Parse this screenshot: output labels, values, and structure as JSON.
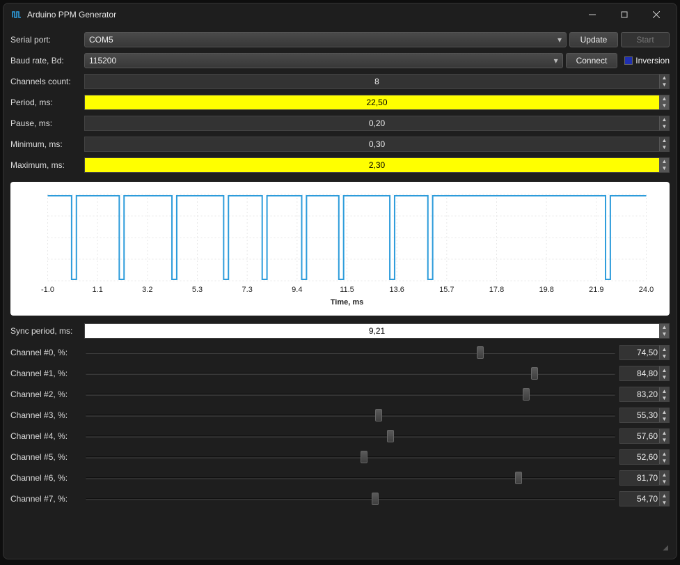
{
  "window": {
    "title": "Arduino PPM Generator"
  },
  "toolbar": {
    "serial_port_label": "Serial port:",
    "baud_rate_label": "Baud rate, Bd:",
    "serial_port_value": "COM5",
    "baud_rate_value": "115200",
    "update_label": "Update",
    "connect_label": "Connect",
    "start_label": "Start",
    "inversion_label": "Inversion",
    "inversion_checked": false
  },
  "params": {
    "channels_label": "Channels count:",
    "channels_value": "8",
    "period_label": "Period, ms:",
    "period_value": "22,50",
    "period_highlight": true,
    "pause_label": "Pause, ms:",
    "pause_value": "0,20",
    "minimum_label": "Minimum, ms:",
    "minimum_value": "0,30",
    "maximum_label": "Maximum, ms:",
    "maximum_value": "2,30",
    "maximum_highlight": true
  },
  "chart_data": {
    "type": "line",
    "xlabel": "Time, ms",
    "xlim": [
      -1.0,
      24.0
    ],
    "ylim": [
      0,
      1
    ],
    "x_ticks": [
      "-1.0",
      "1.1",
      "3.2",
      "5.3",
      "7.3",
      "9.4",
      "11.5",
      "13.6",
      "15.7",
      "17.8",
      "19.8",
      "21.9",
      "24.0"
    ],
    "pulses": [
      {
        "start": 0.0,
        "width": 0.2,
        "level_after": 1.79
      },
      {
        "start": 1.99,
        "width": 0.2,
        "level_after": 2.0
      },
      {
        "start": 4.19,
        "width": 0.2,
        "level_after": 1.96
      },
      {
        "start": 6.35,
        "width": 0.2,
        "level_after": 1.41
      },
      {
        "start": 7.96,
        "width": 0.2,
        "level_after": 1.45
      },
      {
        "start": 9.61,
        "width": 0.2,
        "level_after": 1.35
      },
      {
        "start": 11.16,
        "width": 0.2,
        "level_after": 1.93
      },
      {
        "start": 13.29,
        "width": 0.2,
        "level_after": 1.39
      },
      {
        "start": 14.88,
        "width": 0.2,
        "level_after": 7.42
      },
      {
        "start": 22.3,
        "width": 0.2,
        "level_after": 1.7
      }
    ]
  },
  "sync": {
    "label": "Sync period, ms:",
    "value": "9,21"
  },
  "channels": [
    {
      "label": "Channel #0, %:",
      "value": "74,50",
      "pct": 74.5
    },
    {
      "label": "Channel #1, %:",
      "value": "84,80",
      "pct": 84.8
    },
    {
      "label": "Channel #2, %:",
      "value": "83,20",
      "pct": 83.2
    },
    {
      "label": "Channel #3, %:",
      "value": "55,30",
      "pct": 55.3
    },
    {
      "label": "Channel #4, %:",
      "value": "57,60",
      "pct": 57.6
    },
    {
      "label": "Channel #5, %:",
      "value": "52,60",
      "pct": 52.6
    },
    {
      "label": "Channel #6, %:",
      "value": "81,70",
      "pct": 81.7
    },
    {
      "label": "Channel #7, %:",
      "value": "54,70",
      "pct": 54.7
    }
  ]
}
